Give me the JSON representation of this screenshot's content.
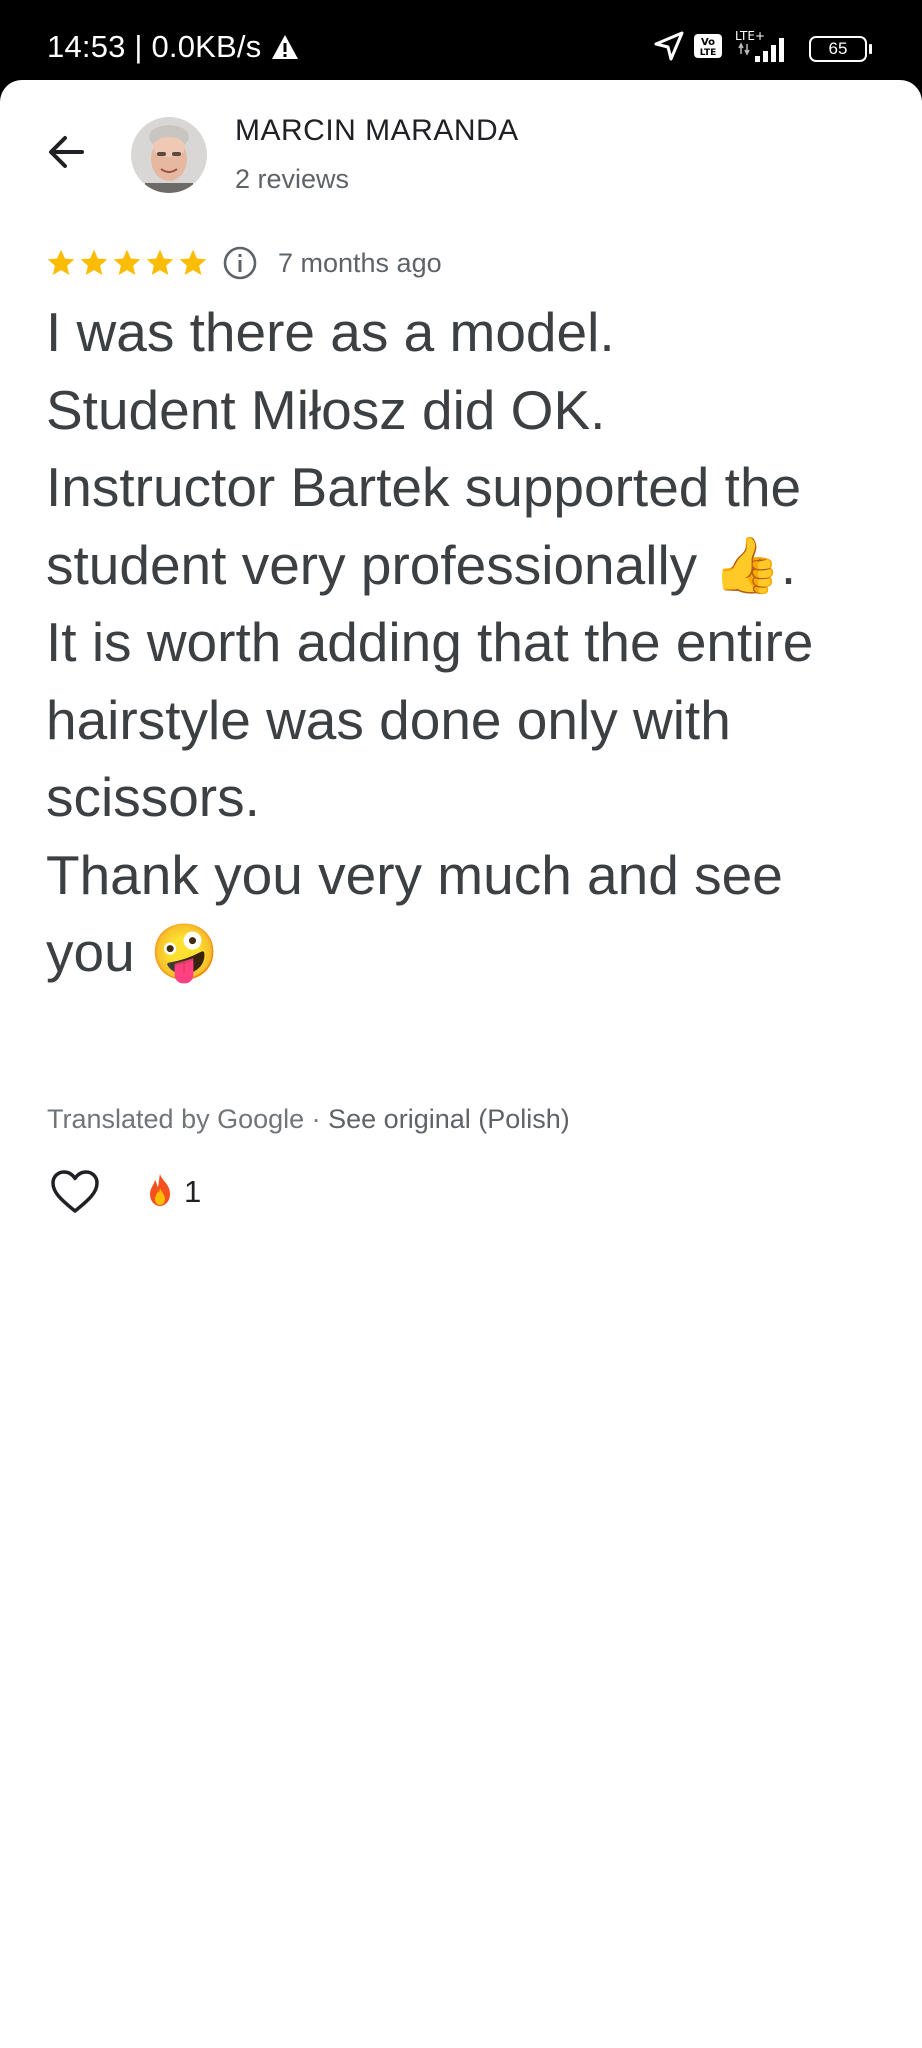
{
  "status_bar": {
    "time_speed": "14:53 | 0.0KB/s",
    "battery": "65",
    "volte": "Vo LTE",
    "network": "LTE+"
  },
  "review": {
    "reviewer_name": "MARCIN MARANDA",
    "reviewer_count": "2 reviews",
    "rating": 5,
    "rating_max": 5,
    "star_color": "#FBBC04",
    "time_ago": "7 months ago",
    "lines": [
      "I was there as a model.",
      "Student Miłosz did OK.",
      "Instructor Bartek supported the",
      "student very professionally 👍.",
      "It is worth adding that the entire",
      "hairstyle was done only with",
      "scissors.",
      "Thank you very much and see",
      "you 🤪"
    ],
    "translated_by": "Translated by Google · ",
    "see_original": "See original (Polish)"
  },
  "actions": {
    "like_icon": "heart-outline-icon",
    "reaction_emoji": "🔥",
    "reaction_count": "1"
  }
}
